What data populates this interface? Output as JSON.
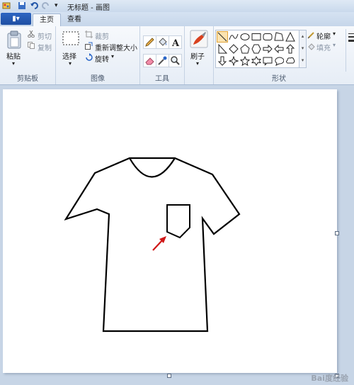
{
  "titlebar": {
    "title": "无标题 - 画图"
  },
  "tabs": {
    "file_label": "▮▾",
    "home": "主页",
    "view": "查看"
  },
  "clipboard": {
    "paste": "粘贴",
    "cut": "剪切",
    "copy": "复制",
    "group": "剪贴板"
  },
  "image": {
    "select": "选择",
    "crop": "裁剪",
    "resize": "重新调整大小",
    "rotate": "旋转",
    "group": "图像"
  },
  "tools": {
    "group": "工具"
  },
  "brushes": {
    "label": "刷子"
  },
  "shapes": {
    "outline": "轮廓",
    "fill": "填充",
    "group": "形状"
  },
  "watermark": "Bai度经验"
}
